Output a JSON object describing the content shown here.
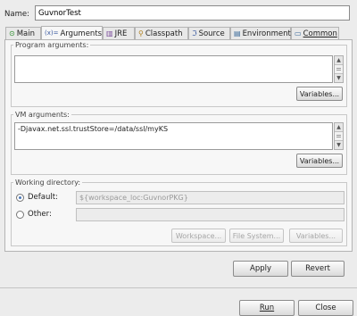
{
  "name_field": {
    "label": "Name:",
    "value": "GuvnorTest"
  },
  "tabs": [
    {
      "label": "Main",
      "icon": "main-tab-icon"
    },
    {
      "label": "Arguments",
      "icon": "arguments-tab-icon",
      "active": true
    },
    {
      "label": "JRE",
      "icon": "jre-icon"
    },
    {
      "label": "Classpath",
      "icon": "classpath-icon"
    },
    {
      "label": "Source",
      "icon": "source-icon"
    },
    {
      "label": "Environment",
      "icon": "environment-icon"
    },
    {
      "label": "Common",
      "icon": "common-icon"
    }
  ],
  "program_args": {
    "legend": "Program arguments:",
    "value": "",
    "variables_button": "Variables..."
  },
  "vm_args": {
    "legend": "VM arguments:",
    "value": "-Djavax.net.ssl.trustStore=/data/ssl/myKS",
    "variables_button": "Variables..."
  },
  "working_dir": {
    "legend": "Working directory:",
    "default_label": "Default:",
    "default_value": "${workspace_loc:GuvnorPKG}",
    "other_label": "Other:",
    "other_value": "",
    "workspace_button": "Workspace...",
    "filesystem_button": "File System...",
    "variables_button": "Variables..."
  },
  "footer": {
    "apply": "Apply",
    "revert": "Revert",
    "run": "Run",
    "close": "Close"
  },
  "colors": {
    "panel": "#f7f7f7",
    "background": "#ececec",
    "radio_accent": "#4c78b8"
  }
}
